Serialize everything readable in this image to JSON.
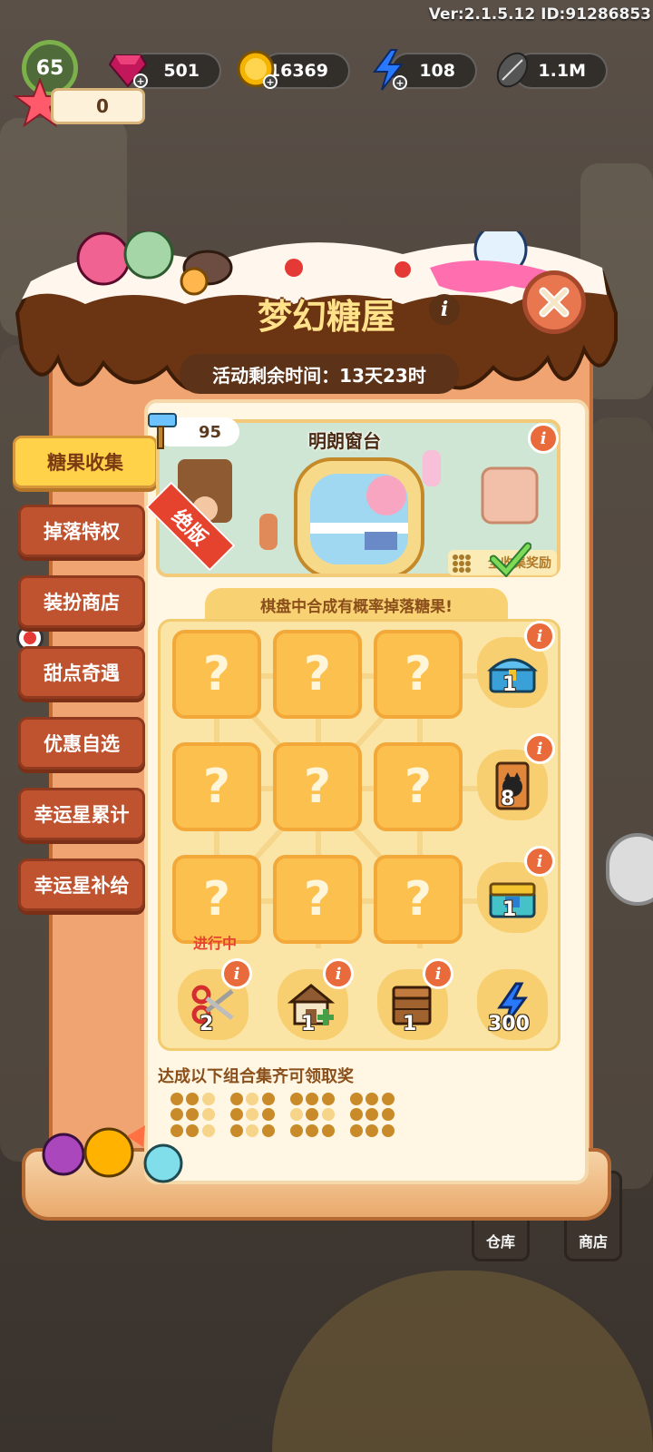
{
  "version_label": "Ver:2.1.5.12 ID:91286853",
  "hud": {
    "level": "65",
    "gems": "501",
    "coins": "16369",
    "energy": "108",
    "seeds": "1.1M",
    "stars": "0"
  },
  "panel": {
    "title": "梦幻糖屋",
    "timer": "活动剩余时间：13天23时",
    "tabs": [
      "糖果收集",
      "掉落特权",
      "装扮商店",
      "甜点奇遇",
      "优惠自选",
      "幸运星累计",
      "幸运星补给"
    ],
    "banner": {
      "count": "95",
      "name": "明朗窗台",
      "ribbon": "绝版",
      "full_reward": "全收集奖励"
    },
    "hint": "棋盘中合成有概率掉落糖果!",
    "question_mark": "?",
    "in_progress": "进行中",
    "row_rewards": [
      {
        "icon": "blue-chest-icon",
        "count": "1"
      },
      {
        "icon": "cat-food-bag-icon",
        "count": "8"
      },
      {
        "icon": "gem-chest-icon",
        "count": "1"
      }
    ],
    "column_rewards": [
      {
        "icon": "scissors-icon",
        "count": "2"
      },
      {
        "icon": "house-upgrade-icon",
        "count": "1"
      },
      {
        "icon": "wooden-crate-icon",
        "count": "1"
      },
      {
        "icon": "lightning-icon",
        "count": "300"
      }
    ],
    "combo_label": "达成以下组合集齐可领取奖",
    "info_glyph": "i"
  },
  "bottom": {
    "shop_label_1": "仓库",
    "shop_label_2": "商店"
  },
  "colors": {
    "accent": "#ffd24a",
    "tab": "#c0532f",
    "cell": "#fcc04f",
    "ribbon": "#e5432e"
  }
}
